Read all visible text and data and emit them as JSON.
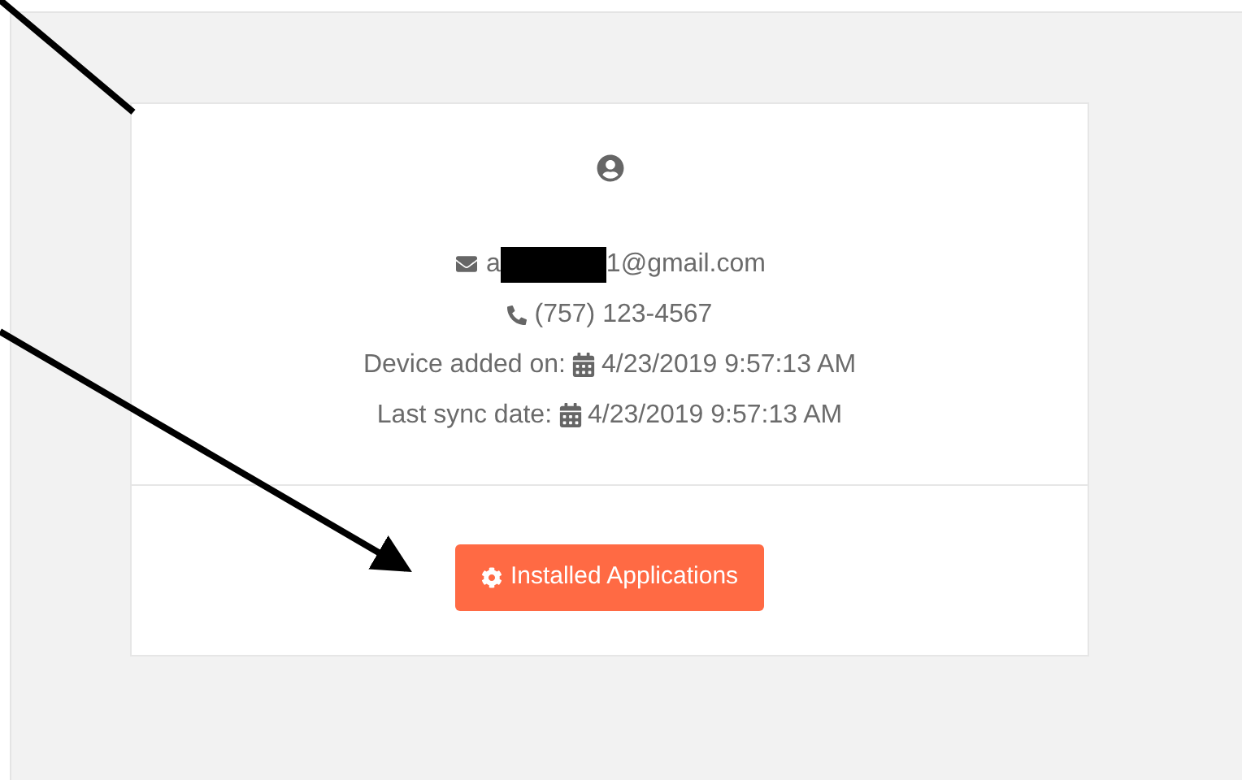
{
  "profile": {
    "email_start": "a",
    "email_end": "1@gmail.com",
    "phone": "(757) 123-4567",
    "details": [
      {
        "label": "Device added on:",
        "value": "4/23/2019 9:57:13 AM"
      },
      {
        "label": "Last sync date:",
        "value": "4/23/2019 9:57:13 AM"
      }
    ]
  },
  "button": {
    "label": "Installed Applications"
  }
}
